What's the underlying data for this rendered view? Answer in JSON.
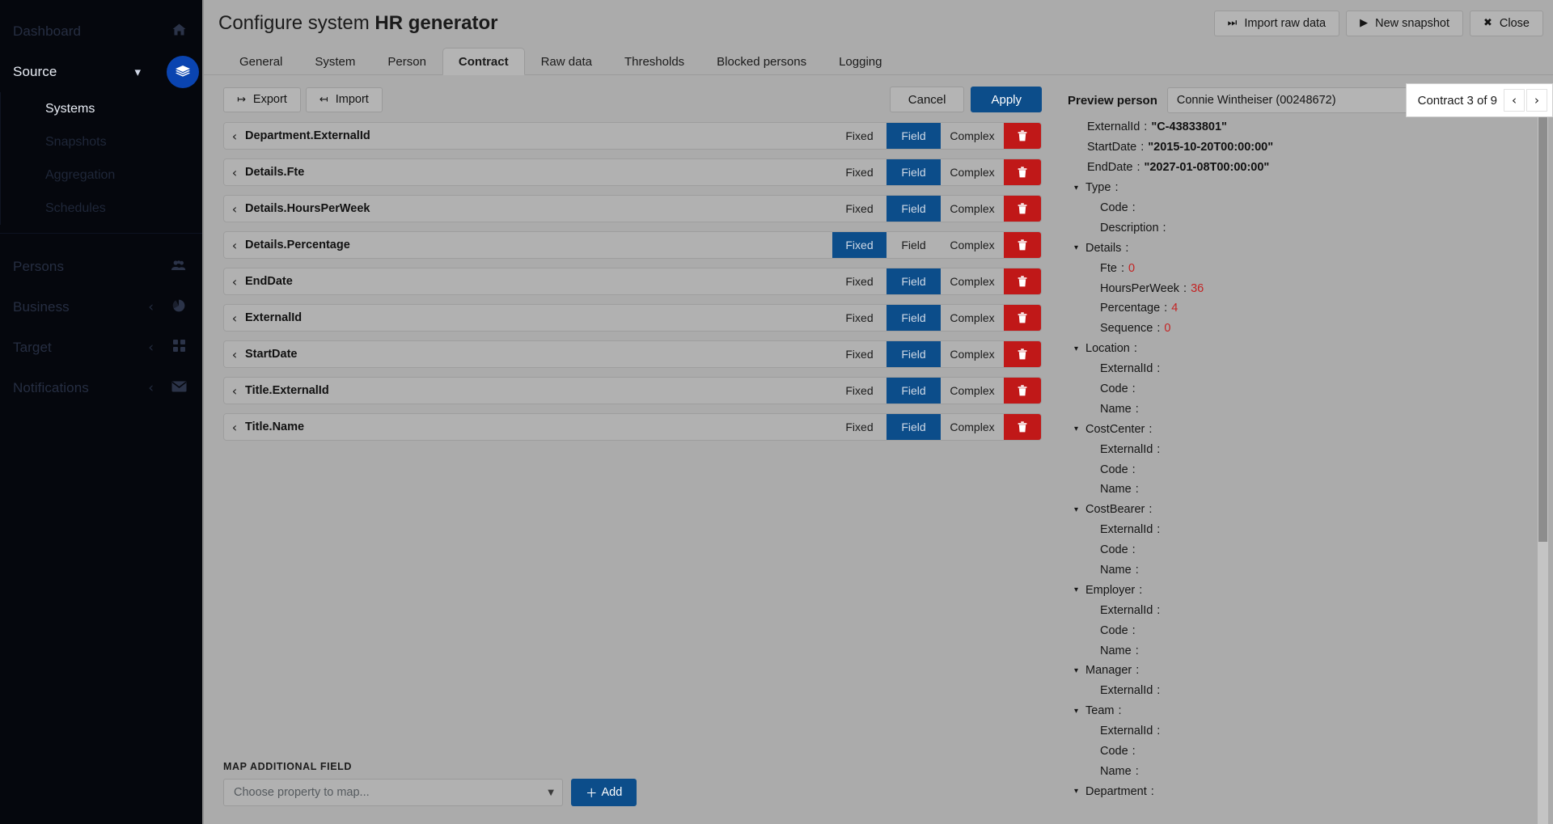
{
  "sidebar": {
    "items": [
      {
        "label": "Dashboard",
        "icon": "home-icon",
        "state": "dim",
        "chevron": ""
      },
      {
        "label": "Source",
        "icon": "layers-icon",
        "state": "active",
        "chevron": "down"
      }
    ],
    "source_children": [
      {
        "label": "Systems",
        "active": true
      },
      {
        "label": "Snapshots",
        "active": false
      },
      {
        "label": "Aggregation",
        "active": false
      },
      {
        "label": "Schedules",
        "active": false
      }
    ],
    "lower_items": [
      {
        "label": "Persons",
        "icon": "people-icon",
        "chevron": ""
      },
      {
        "label": "Business",
        "icon": "pie-chart-icon",
        "chevron": "left"
      },
      {
        "label": "Target",
        "icon": "grid-icon",
        "chevron": "left"
      },
      {
        "label": "Notifications",
        "icon": "mail-icon",
        "chevron": "left"
      }
    ]
  },
  "header": {
    "title_prefix": "Configure system",
    "title_strong": "HR generator",
    "actions": [
      {
        "label": "Import raw data",
        "icon": "step-forward-icon",
        "glyph": "⏭"
      },
      {
        "label": "New snapshot",
        "icon": "play-icon",
        "glyph": "▶"
      },
      {
        "label": "Close",
        "icon": "close-icon",
        "glyph": "✖"
      }
    ]
  },
  "tabs": [
    {
      "label": "General",
      "active": false
    },
    {
      "label": "System",
      "active": false
    },
    {
      "label": "Person",
      "active": false
    },
    {
      "label": "Contract",
      "active": true
    },
    {
      "label": "Raw data",
      "active": false
    },
    {
      "label": "Thresholds",
      "active": false
    },
    {
      "label": "Blocked persons",
      "active": false
    },
    {
      "label": "Logging",
      "active": false
    }
  ],
  "toolbar": {
    "export_label": "Export",
    "export_glyph": "↦",
    "import_label": "Import",
    "import_glyph": "↤",
    "cancel_label": "Cancel",
    "apply_label": "Apply"
  },
  "mapping": {
    "mode_options": [
      "Fixed",
      "Field",
      "Complex"
    ],
    "delete_icon": "trash-icon",
    "collapse_glyph": "‹",
    "rows": [
      {
        "name": "Department.ExternalId",
        "mode": "Field"
      },
      {
        "name": "Details.Fte",
        "mode": "Field"
      },
      {
        "name": "Details.HoursPerWeek",
        "mode": "Field"
      },
      {
        "name": "Details.Percentage",
        "mode": "Fixed"
      },
      {
        "name": "EndDate",
        "mode": "Field"
      },
      {
        "name": "ExternalId",
        "mode": "Field"
      },
      {
        "name": "StartDate",
        "mode": "Field"
      },
      {
        "name": "Title.ExternalId",
        "mode": "Field"
      },
      {
        "name": "Title.Name",
        "mode": "Field"
      }
    ]
  },
  "map_additional": {
    "section_label": "MAP ADDITIONAL FIELD",
    "placeholder": "Choose property to map...",
    "add_label": "Add",
    "add_glyph": "＋"
  },
  "preview": {
    "label": "Preview person",
    "person_value": "Connie Wintheiser (00248672)",
    "clear_glyph": "✕",
    "caret_glyph": "▾",
    "contract_counter": "Contract 3 of 9",
    "prev_glyph": "‹",
    "next_glyph": "›",
    "tree": [
      {
        "indent": 1,
        "arrow": "",
        "key": "ExternalId",
        "value": "\"C-43833801\"",
        "vtype": "string"
      },
      {
        "indent": 1,
        "arrow": "",
        "key": "StartDate",
        "value": "\"2015-10-20T00:00:00\"",
        "vtype": "string"
      },
      {
        "indent": 1,
        "arrow": "",
        "key": "EndDate",
        "value": "\"2027-01-08T00:00:00\"",
        "vtype": "string"
      },
      {
        "indent": 0,
        "arrow": "▾",
        "key": "Type",
        "value": "",
        "vtype": "none"
      },
      {
        "indent": 2,
        "arrow": "",
        "key": "Code",
        "value": "",
        "vtype": "none"
      },
      {
        "indent": 2,
        "arrow": "",
        "key": "Description",
        "value": "",
        "vtype": "none"
      },
      {
        "indent": 0,
        "arrow": "▾",
        "key": "Details",
        "value": "",
        "vtype": "none"
      },
      {
        "indent": 2,
        "arrow": "",
        "key": "Fte",
        "value": "0",
        "vtype": "number"
      },
      {
        "indent": 2,
        "arrow": "",
        "key": "HoursPerWeek",
        "value": "36",
        "vtype": "number"
      },
      {
        "indent": 2,
        "arrow": "",
        "key": "Percentage",
        "value": "4",
        "vtype": "number"
      },
      {
        "indent": 2,
        "arrow": "",
        "key": "Sequence",
        "value": "0",
        "vtype": "number"
      },
      {
        "indent": 0,
        "arrow": "▾",
        "key": "Location",
        "value": "",
        "vtype": "none"
      },
      {
        "indent": 2,
        "arrow": "",
        "key": "ExternalId",
        "value": "",
        "vtype": "none"
      },
      {
        "indent": 2,
        "arrow": "",
        "key": "Code",
        "value": "",
        "vtype": "none"
      },
      {
        "indent": 2,
        "arrow": "",
        "key": "Name",
        "value": "",
        "vtype": "none"
      },
      {
        "indent": 0,
        "arrow": "▾",
        "key": "CostCenter",
        "value": "",
        "vtype": "none"
      },
      {
        "indent": 2,
        "arrow": "",
        "key": "ExternalId",
        "value": "",
        "vtype": "none"
      },
      {
        "indent": 2,
        "arrow": "",
        "key": "Code",
        "value": "",
        "vtype": "none"
      },
      {
        "indent": 2,
        "arrow": "",
        "key": "Name",
        "value": "",
        "vtype": "none"
      },
      {
        "indent": 0,
        "arrow": "▾",
        "key": "CostBearer",
        "value": "",
        "vtype": "none"
      },
      {
        "indent": 2,
        "arrow": "",
        "key": "ExternalId",
        "value": "",
        "vtype": "none"
      },
      {
        "indent": 2,
        "arrow": "",
        "key": "Code",
        "value": "",
        "vtype": "none"
      },
      {
        "indent": 2,
        "arrow": "",
        "key": "Name",
        "value": "",
        "vtype": "none"
      },
      {
        "indent": 0,
        "arrow": "▾",
        "key": "Employer",
        "value": "",
        "vtype": "none"
      },
      {
        "indent": 2,
        "arrow": "",
        "key": "ExternalId",
        "value": "",
        "vtype": "none"
      },
      {
        "indent": 2,
        "arrow": "",
        "key": "Code",
        "value": "",
        "vtype": "none"
      },
      {
        "indent": 2,
        "arrow": "",
        "key": "Name",
        "value": "",
        "vtype": "none"
      },
      {
        "indent": 0,
        "arrow": "▾",
        "key": "Manager",
        "value": "",
        "vtype": "none"
      },
      {
        "indent": 2,
        "arrow": "",
        "key": "ExternalId",
        "value": "",
        "vtype": "none"
      },
      {
        "indent": 0,
        "arrow": "▾",
        "key": "Team",
        "value": "",
        "vtype": "none"
      },
      {
        "indent": 2,
        "arrow": "",
        "key": "ExternalId",
        "value": "",
        "vtype": "none"
      },
      {
        "indent": 2,
        "arrow": "",
        "key": "Code",
        "value": "",
        "vtype": "none"
      },
      {
        "indent": 2,
        "arrow": "",
        "key": "Name",
        "value": "",
        "vtype": "none"
      },
      {
        "indent": 0,
        "arrow": "▾",
        "key": "Department",
        "value": "",
        "vtype": "none"
      }
    ]
  },
  "colors": {
    "accent": "#0c4d8a",
    "danger": "#c01818",
    "sidebar_bg": "#05070d",
    "chrome_bg": "#ababab",
    "number_value": "#c42323"
  }
}
